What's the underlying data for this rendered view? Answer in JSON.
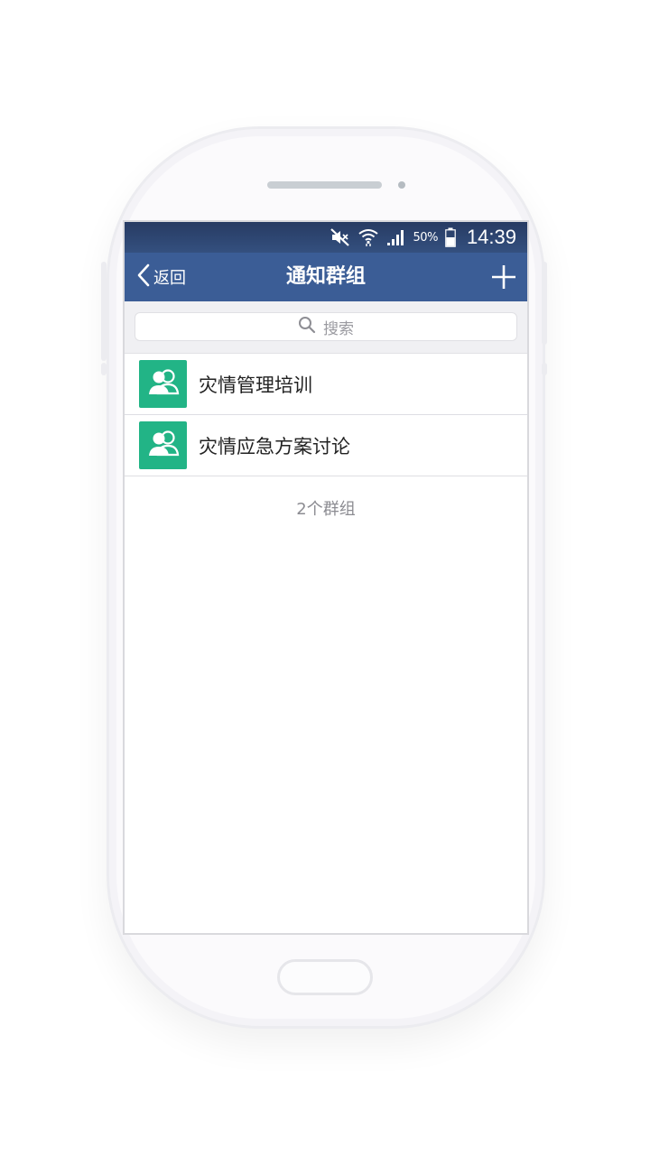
{
  "status_bar": {
    "battery_percent": "50%",
    "time": "14:39",
    "icons": [
      "mute-icon",
      "wifi-icon",
      "signal-icon",
      "battery-icon"
    ]
  },
  "nav": {
    "back_label": "返回",
    "title": "通知群组",
    "add_icon": "plus-icon"
  },
  "search": {
    "placeholder": "搜索",
    "icon": "search-icon"
  },
  "groups": [
    {
      "name": "灾情管理培训",
      "icon": "group-icon"
    },
    {
      "name": "灾情应急方案讨论",
      "icon": "group-icon"
    }
  ],
  "footer": {
    "count_label": "2个群组"
  },
  "colors": {
    "nav_bar": "#3b5d96",
    "status_bar": "#2c4370",
    "avatar": "#22b486",
    "background": "#f0f0f3"
  }
}
